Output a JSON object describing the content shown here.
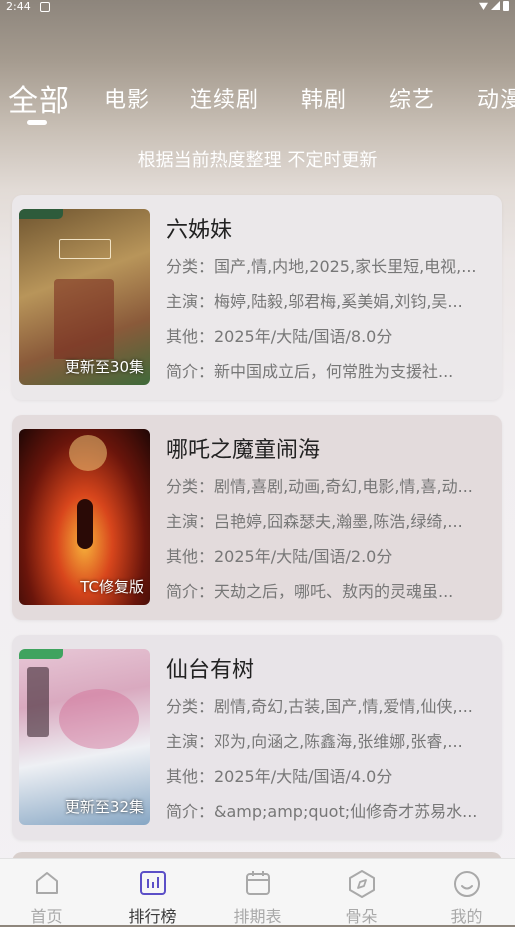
{
  "status_bar": {
    "time": "2:44"
  },
  "tabs": [
    {
      "label": "全部",
      "active": true
    },
    {
      "label": "电影"
    },
    {
      "label": "连续剧"
    },
    {
      "label": "韩剧"
    },
    {
      "label": "综艺"
    },
    {
      "label": "动漫"
    }
  ],
  "subtitle": "根据当前热度整理 不定时更新",
  "cards": [
    {
      "title": "六姊妹",
      "badge": "更新至30集",
      "category": "分类：国产,情,内地,2025,家长里短,电视,...",
      "cast": "主演：梅婷,陆毅,邬君梅,奚美娟,刘钧,吴...",
      "other": "其他：2025年/大陆/国语/8.0分",
      "intro": "简介：新中国成立后，何常胜为支援社...",
      "card_color": "#ebe8ea",
      "poster_colors": [
        "#8a6c3a",
        "#c7a86b",
        "#5d8a4b"
      ]
    },
    {
      "title": "哪吒之魔童闹海",
      "badge": "TC修复版",
      "category": "分类：剧情,喜剧,动画,奇幻,电影,情,喜,动...",
      "cast": "主演：吕艳婷,囧森瑟夫,瀚墨,陈浩,绿绮,...",
      "other": "其他：2025年/大陆/国语/2.0分",
      "intro": "简介：天劫之后，哪吒、敖丙的灵魂虽...",
      "card_color": "#e3dbdc",
      "poster_colors": [
        "#2a0f08",
        "#c2391a",
        "#f5a623"
      ]
    },
    {
      "title": "仙台有树",
      "badge": "更新至32集",
      "category": "分类：剧情,奇幻,古装,国产,情,爱情,仙侠,...",
      "cast": "主演：邓为,向涵之,陈鑫海,张维娜,张睿,...",
      "other": "其他：2025年/大陆/国语/4.0分",
      "intro": "简介：&amp;amp;quot;仙修奇才苏易水...",
      "card_color": "#e8e4e8",
      "poster_colors": [
        "#d9b6c8",
        "#e9dbe5",
        "#7d9bb8"
      ]
    }
  ],
  "nav": [
    {
      "label": "首页",
      "icon": "home-icon"
    },
    {
      "label": "排行榜",
      "icon": "ranking-icon",
      "active": true
    },
    {
      "label": "排期表",
      "icon": "calendar-icon"
    },
    {
      "label": "骨朵",
      "icon": "compass-icon"
    },
    {
      "label": "我的",
      "icon": "smiley-icon"
    }
  ],
  "colors": {
    "accent": "#5b4fc7",
    "nav_inactive": "#a9a9a9"
  }
}
